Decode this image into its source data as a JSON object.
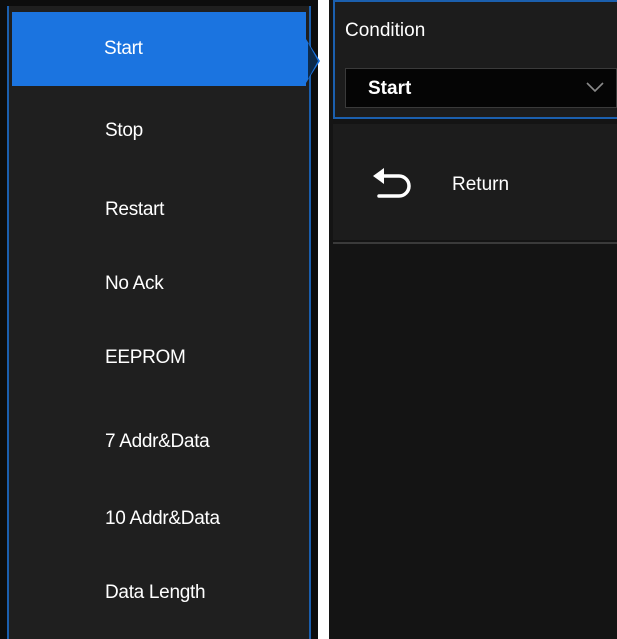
{
  "menu": {
    "items": [
      {
        "label": "Start",
        "selected": true
      },
      {
        "label": "Stop"
      },
      {
        "label": "Restart"
      },
      {
        "label": "No Ack"
      },
      {
        "label": "EEPROM"
      },
      {
        "label": "7 Addr&Data"
      },
      {
        "label": "10 Addr&Data"
      },
      {
        "label": "Data Length"
      }
    ]
  },
  "condition": {
    "label": "Condition",
    "value": "Start"
  },
  "return_button": {
    "label": "Return"
  },
  "colors": {
    "accent": "#1b74e0",
    "border": "#1b5fae",
    "background": "#1f1f1f"
  }
}
